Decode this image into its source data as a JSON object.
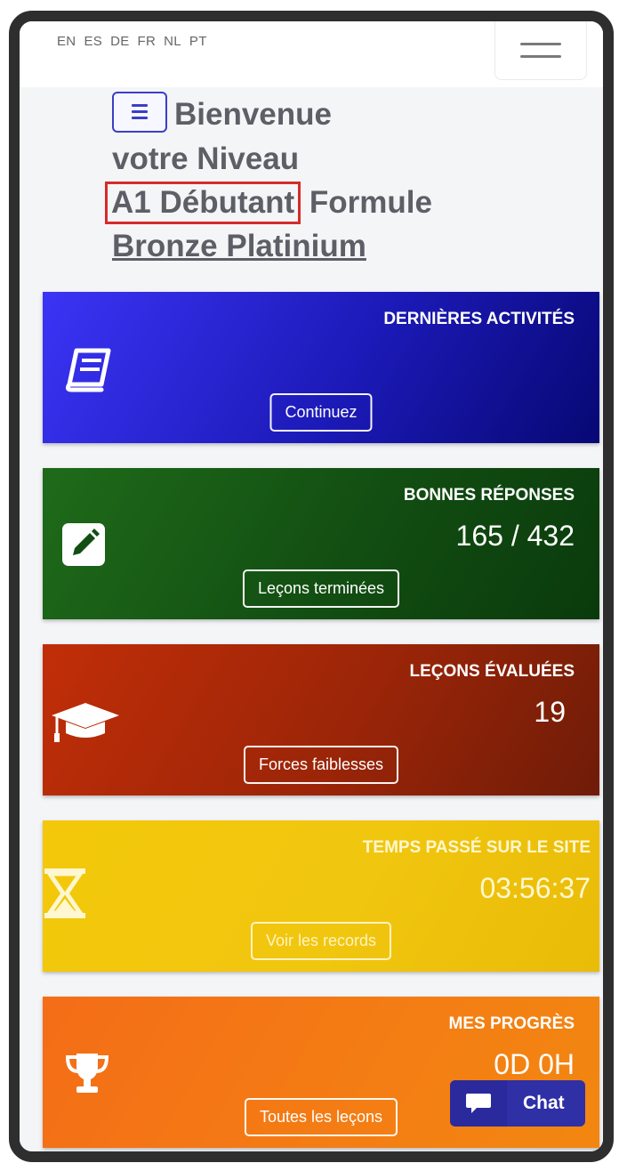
{
  "languages": [
    "EN",
    "ES",
    "DE",
    "FR",
    "NL",
    "PT"
  ],
  "welcome": {
    "greeting": "Bienvenue",
    "line2": "votre Niveau",
    "level": "A1 Débutant",
    "formula_label": "Formule",
    "plan": "Bronze Platinium"
  },
  "cards": [
    {
      "title": "DERNIÈRES ACTIVITÉS",
      "value": "",
      "button": "Continuez",
      "icon": "book-icon",
      "color": "#1c1ab8"
    },
    {
      "title": "BONNES RÉPONSES",
      "value": "165 / 432",
      "button": "Leçons terminées",
      "icon": "pencil-square-icon",
      "color": "#124e12"
    },
    {
      "title": "LEÇONS ÉVALUÉES",
      "value": "19",
      "button": "Forces faiblesses",
      "icon": "graduation-cap-icon",
      "color": "#9b2508"
    },
    {
      "title": "TEMPS PASSÉ SUR LE SITE",
      "value": "03:56:37",
      "button": "Voir les records",
      "icon": "hourglass-icon",
      "color": "#f1c60f"
    },
    {
      "title": "MES PROGRÈS",
      "value": "0D 0H",
      "button": "Toutes les leçons",
      "icon": "trophy-icon",
      "color": "#f47c14"
    }
  ],
  "chat": {
    "label": "Chat",
    "color": "#2f2fa6"
  }
}
